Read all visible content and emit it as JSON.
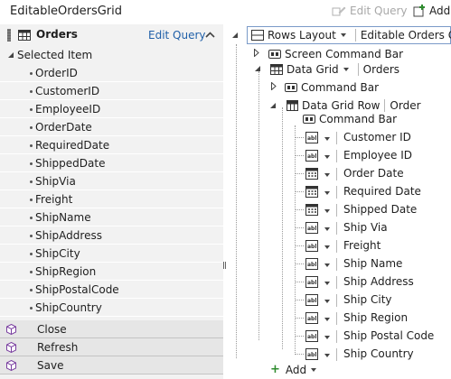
{
  "toolbar": {
    "title": "EditableOrdersGrid",
    "edit_query_label": "Edit Query",
    "add_label": "Add Data Item..."
  },
  "left_pane": {
    "header_title": "Orders",
    "edit_query_link": "Edit Query",
    "selected_item_label": "Selected Item",
    "fields": [
      "OrderID",
      "CustomerID",
      "EmployeeID",
      "OrderDate",
      "RequiredDate",
      "ShippedDate",
      "ShipVia",
      "Freight",
      "ShipName",
      "ShipAddress",
      "ShipCity",
      "ShipRegion",
      "ShipPostalCode",
      "ShipCountry"
    ],
    "methods": [
      "Close",
      "Refresh",
      "Save"
    ]
  },
  "tree": {
    "root_layout": "Rows Layout",
    "root_name": "Editable Orders Grid",
    "screen_command_bar": "Screen Command Bar",
    "data_grid": "Data Grid",
    "data_grid_source": "Orders",
    "grid_command_bar": "Command Bar",
    "data_grid_row": "Data Grid Row",
    "data_grid_row_source": "Order",
    "row_command_bar": "Command Bar",
    "fields": [
      {
        "label": "Customer ID",
        "icon": "text-box-icon"
      },
      {
        "label": "Employee ID",
        "icon": "text-box-icon"
      },
      {
        "label": "Order Date",
        "icon": "date-picker-icon"
      },
      {
        "label": "Required Date",
        "icon": "date-picker-icon"
      },
      {
        "label": "Shipped Date",
        "icon": "date-picker-icon"
      },
      {
        "label": "Ship Via",
        "icon": "text-box-icon"
      },
      {
        "label": "Freight",
        "icon": "text-box-icon"
      },
      {
        "label": "Ship Name",
        "icon": "text-box-icon"
      },
      {
        "label": "Ship Address",
        "icon": "text-box-icon"
      },
      {
        "label": "Ship City",
        "icon": "text-box-icon"
      },
      {
        "label": "Ship Region",
        "icon": "text-box-icon"
      },
      {
        "label": "Ship Postal Code",
        "icon": "text-box-icon"
      },
      {
        "label": "Ship Country",
        "icon": "text-box-icon"
      }
    ],
    "add_label": "Add"
  },
  "colors": {
    "link": "#1f5fa8",
    "left_bg": "#f2f2f2",
    "method_icon": "#7a3fa0",
    "add_plus": "#2e8b2e"
  }
}
